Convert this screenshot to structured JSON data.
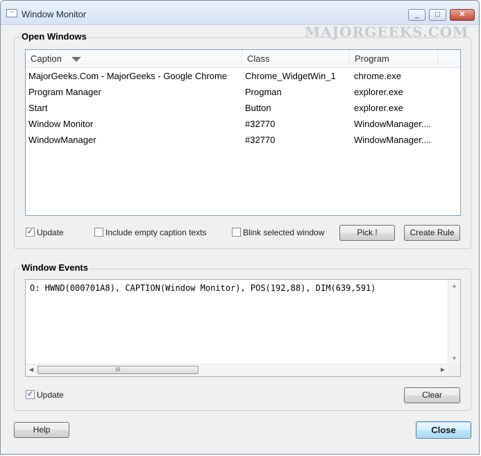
{
  "window": {
    "title": "Window Monitor",
    "icon": "window-app-icon",
    "controls": {
      "minimize": "_",
      "maximize": "□",
      "close": "✕"
    }
  },
  "watermark": "MAJORGEEKS.COM",
  "open_windows": {
    "title": "Open Windows",
    "columns": [
      "Caption",
      "Class",
      "Program"
    ],
    "rows": [
      [
        "MajorGeeks.Com - MajorGeeks - Google Chrome",
        "Chrome_WidgetWin_1",
        "chrome.exe"
      ],
      [
        "Program Manager",
        "Progman",
        "explorer.exe"
      ],
      [
        "Start",
        "Button",
        "explorer.exe"
      ],
      [
        "Window Monitor",
        "#32770",
        "WindowManager...."
      ],
      [
        "WindowManager",
        "#32770",
        "WindowManager...."
      ]
    ],
    "update_label": "Update",
    "update_checked": "✓",
    "empty_caption_label": "Include empty caption texts",
    "blink_label": "Blink selected window",
    "pick_label": "Pick !",
    "create_rule_label": "Create Rule"
  },
  "window_events": {
    "title": "Window Events",
    "log": "O: HWND(000701A8), CAPTION(Window Monitor), POS(192,88), DIM(639,591)",
    "update_label": "Update",
    "update_checked": "✓",
    "clear_label": "Clear",
    "hscroll_grip": "III"
  },
  "footer": {
    "help_label": "Help",
    "close_label": "Close"
  }
}
